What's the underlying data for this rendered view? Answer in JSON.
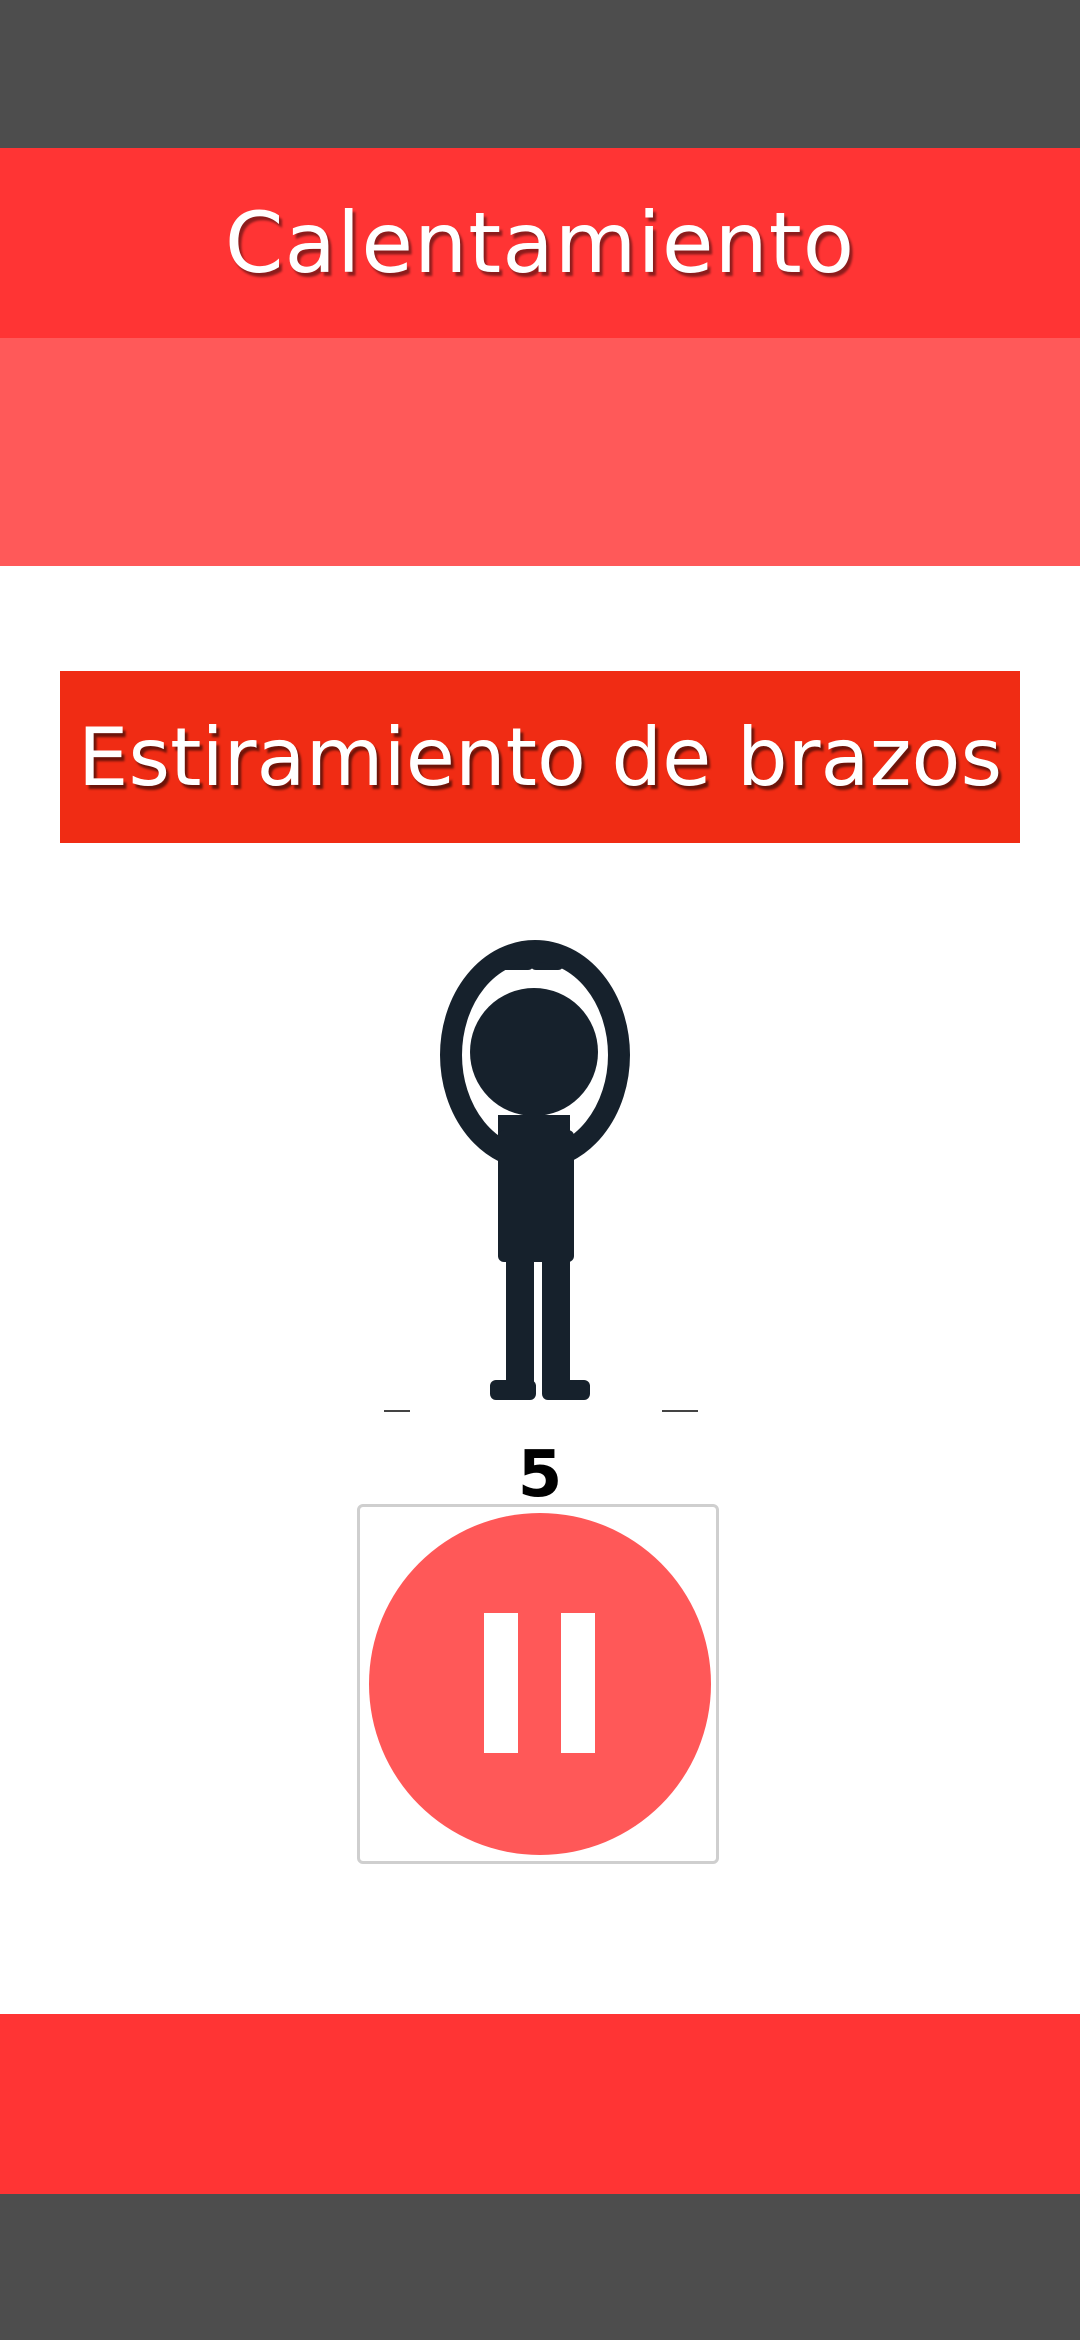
{
  "app_bar": {
    "title": "Calentamiento"
  },
  "exercise": {
    "name": "Estiramiento de brazos",
    "counter": "5"
  },
  "controls": {
    "pause_icon": "pause-icon"
  },
  "colors": {
    "status_bar": "#4d4d4d",
    "app_bar": "#ff3434",
    "header_band": "#ff5959",
    "exercise_banner": "#f02c14",
    "pause_circle": "#ff5858",
    "footer_band": "#ff3434",
    "figure": "#16212c"
  }
}
